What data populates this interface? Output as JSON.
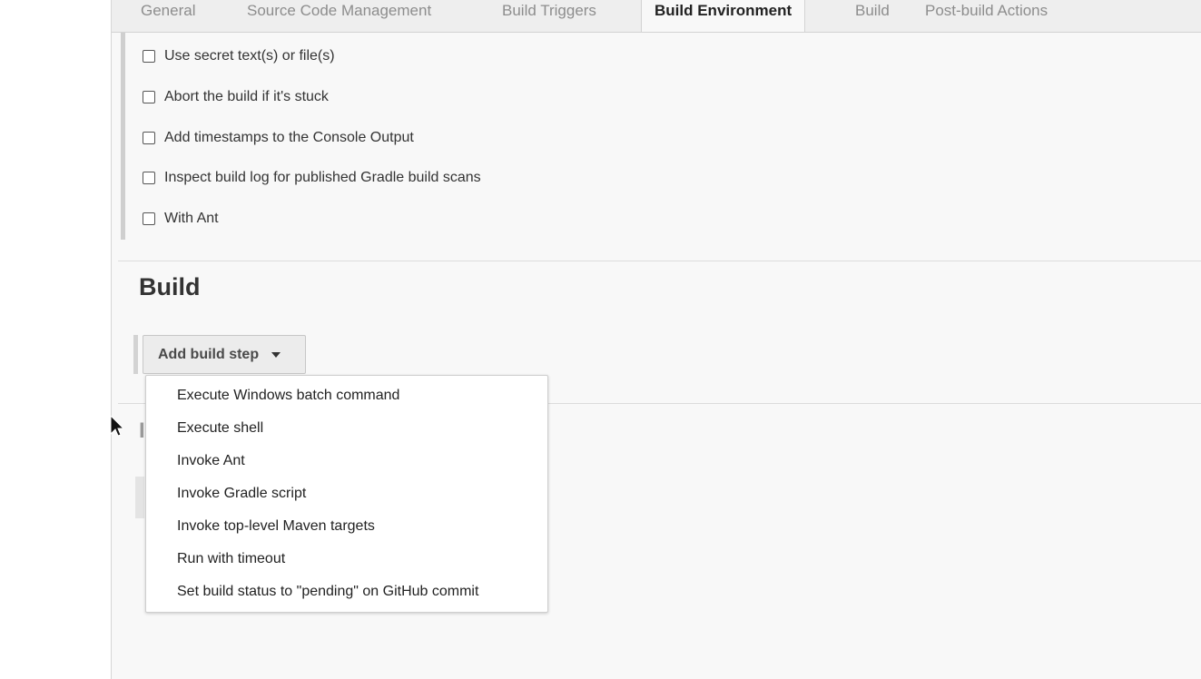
{
  "tabs": [
    {
      "label": "General"
    },
    {
      "label": "Source Code Management"
    },
    {
      "label": "Build Triggers"
    },
    {
      "label": "Build Environment",
      "active": true
    },
    {
      "label": "Build"
    },
    {
      "label": "Post-build Actions"
    }
  ],
  "build_environment": {
    "options": [
      {
        "label": "Use secret text(s) or file(s)",
        "checked": false
      },
      {
        "label": "Abort the build if it's stuck",
        "checked": false
      },
      {
        "label": "Add timestamps to the Console Output",
        "checked": false
      },
      {
        "label": "Inspect build log for published Gradle build scans",
        "checked": false
      },
      {
        "label": "With Ant",
        "checked": false
      }
    ]
  },
  "build": {
    "title": "Build",
    "add_step_label": "Add build step",
    "menu_items": [
      {
        "label": "Execute Windows batch command"
      },
      {
        "label": "Execute shell"
      },
      {
        "label": "Invoke Ant"
      },
      {
        "label": "Invoke Gradle script"
      },
      {
        "label": "Invoke top-level Maven targets"
      },
      {
        "label": "Run with timeout"
      },
      {
        "label": "Set build status to \"pending\" on GitHub commit"
      }
    ]
  },
  "icons": {
    "caret": "chevron-down-icon",
    "cursor": "mouse-pointer-icon"
  },
  "colors": {
    "panel_bg": "#f8f8f8",
    "tab_inactive": "#8d8d8d",
    "tab_active": "#222222",
    "section_rail": "#cfcfcf"
  }
}
